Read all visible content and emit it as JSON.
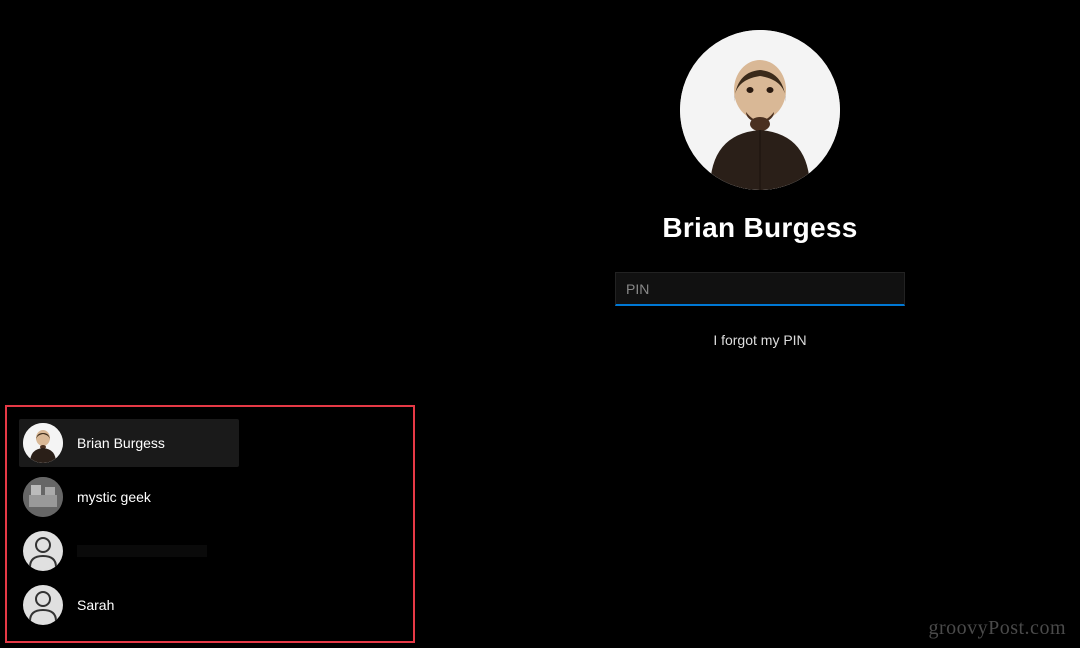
{
  "login": {
    "user_name": "Brian Burgess",
    "pin_placeholder": "PIN",
    "forgot_label": "I forgot my PIN"
  },
  "users": [
    {
      "name": "Brian Burgess",
      "avatar_type": "photo1",
      "selected": true
    },
    {
      "name": "mystic geek",
      "avatar_type": "photo2",
      "selected": false
    },
    {
      "name": "",
      "avatar_type": "generic",
      "selected": false,
      "redacted": true
    },
    {
      "name": "Sarah",
      "avatar_type": "generic",
      "selected": false
    }
  ],
  "watermark": "groovyPost.com",
  "colors": {
    "accent": "#0078d4",
    "highlight_border": "#e63946"
  }
}
